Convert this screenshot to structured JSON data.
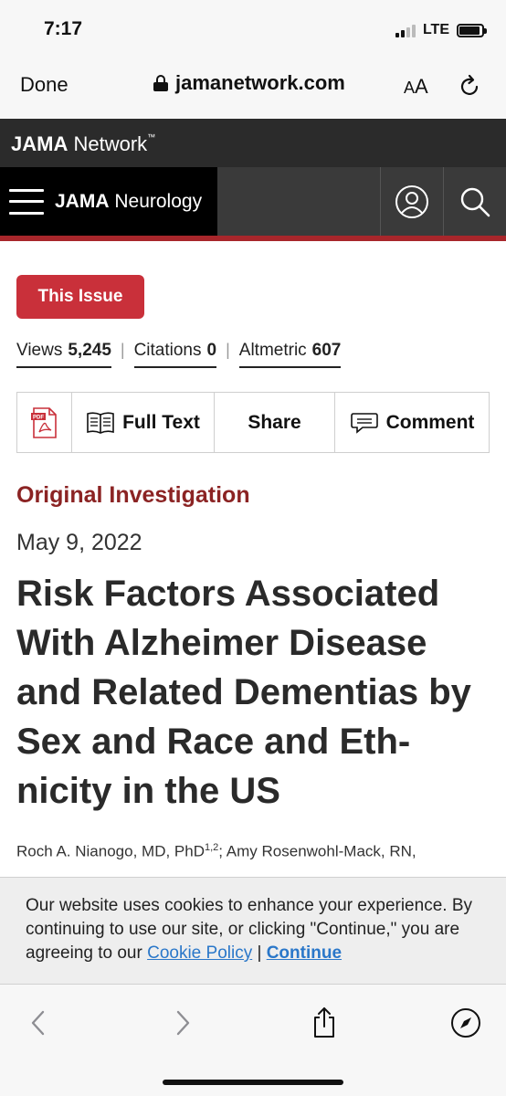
{
  "status_bar": {
    "time": "7:17",
    "network": "LTE",
    "battery_level": 0.9
  },
  "browser": {
    "done_label": "Done",
    "url": "jamanetwork.com",
    "text_size_label_small": "A",
    "text_size_label_large": "A"
  },
  "site": {
    "network_brand_bold": "JAMA",
    "network_brand_rest": " Network",
    "network_brand_mark": "™",
    "journal_bold": "JAMA",
    "journal_rest": " Neurology"
  },
  "article": {
    "this_issue_label": "This Issue",
    "metrics": [
      {
        "label": "Views",
        "value": "5,245"
      },
      {
        "label": "Citations",
        "value": "0"
      },
      {
        "label": "Altmetric",
        "value": "607"
      }
    ],
    "actions": {
      "pdf_badge": "PDF",
      "full_text": "Full Text",
      "share": "Share",
      "comment": "Comment"
    },
    "type": "Original Investigation",
    "date": "May 9, 2022",
    "title": "Risk Factors Associated With Alzheimer Disease and Related Dementias by Sex and Race and Eth-nicity in the US",
    "author1": "Roch A. Nianogo, MD, PhD",
    "author1_affil": "1,2",
    "author2": "; Amy Rosenwohl-Mack, RN,"
  },
  "cookie_banner": {
    "text": "Our website uses cookies to enhance your experience. By continuing to use our site, or clicking \"Continue,\" you are agreeing to our ",
    "policy_link": "Cookie Policy",
    "separator": " | ",
    "continue_link": "Continue"
  },
  "colors": {
    "brand_red": "#c9303a",
    "article_type": "#8b2323",
    "link_blue": "#2a77c9",
    "dark_bar": "#2b2b2b"
  }
}
